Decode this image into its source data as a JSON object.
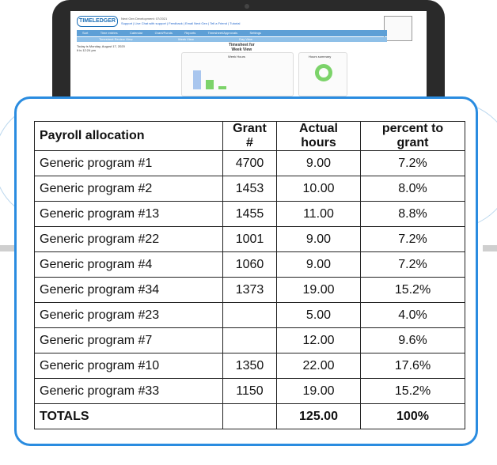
{
  "app": {
    "logo": "TIMELEDGER",
    "company": "Next Gen Development: 07/2021",
    "links": [
      "Support",
      "Live Chat with support",
      "Feedback",
      "Email Next Gen",
      "Tell a Friend",
      "Tutorial"
    ],
    "nav_tabs": [
      "Sort",
      "Time entries",
      "Calendar",
      "Grant/Funds",
      "Reports",
      "Timesheet/Approvals",
      "Settings"
    ],
    "sub_tabs": [
      "Timesheet Review View",
      "Week View",
      "Day View"
    ],
    "date_text": "Today is Monday, August 17, 2020",
    "time_text": "It is 12:24 pm",
    "timesheet_title": "Timesheet for",
    "week_view_label": "Week View",
    "week_chart_title": "Week Hours",
    "hours_summary_title": "Hours summary",
    "continue_link": "- Continue Activities",
    "hide_charts_link": "Hide Charts",
    "prev_next_link": "<Previous Week | Next Week>"
  },
  "table": {
    "headers": [
      "Payroll allocation",
      "Grant #",
      "Actual hours",
      "percent to grant"
    ],
    "rows": [
      [
        "Generic program #1",
        "4700",
        "9.00",
        "7.2%"
      ],
      [
        "Generic program #2",
        "1453",
        "10.00",
        "8.0%"
      ],
      [
        "Generic program #13",
        "1455",
        "11.00",
        "8.8%"
      ],
      [
        "Generic program #22",
        "1001",
        "9.00",
        "7.2%"
      ],
      [
        "Generic program #4",
        "1060",
        "9.00",
        "7.2%"
      ],
      [
        "Generic program #34",
        "1373",
        "19.00",
        "15.2%"
      ],
      [
        "Generic program #23",
        "",
        "5.00",
        "4.0%"
      ],
      [
        "Generic program #7",
        "",
        "12.00",
        "9.6%"
      ],
      [
        "Generic program #10",
        "1350",
        "22.00",
        "17.6%"
      ],
      [
        "Generic program #33",
        "1150",
        "19.00",
        "15.2%"
      ]
    ],
    "totals": [
      "TOTALS",
      "",
      "125.00",
      "100%"
    ]
  },
  "colors": {
    "accent": "#2a8ce0",
    "laptop": "#2a2a2a",
    "nav": "#5d9fd6"
  }
}
